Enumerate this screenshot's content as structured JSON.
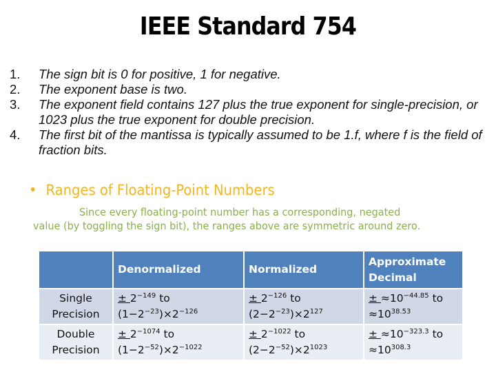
{
  "title": "IEEE Standard 754",
  "rules": [
    {
      "num": "1.",
      "text": "The sign bit is 0 for positive, 1 for negative."
    },
    {
      "num": "2.",
      "text": "The exponent base is two."
    },
    {
      "num": "3.",
      "text": "The exponent field contains 127 plus the true exponent for single-precision, or 1023 plus the true exponent for double precision."
    },
    {
      "num": "4.",
      "text": "The first bit of the mantissa is typically assumed to be 1.f, where f is the field of fraction bits."
    }
  ],
  "section": {
    "bullet": "•",
    "heading": "Ranges of Floating-Point Numbers",
    "note_line1": "Since every floating-point number has a corresponding, negated",
    "note_line2": "value (by toggling the sign bit), the ranges above are symmetric around zero."
  },
  "table": {
    "headers": [
      "",
      "Denormalized",
      "Normalized",
      "Approximate Decimal"
    ],
    "rows": [
      {
        "label": [
          "Single",
          "Precision"
        ],
        "denorm": {
          "a": "± ",
          "b": "2",
          "bsup": "−149",
          "c": " to",
          "d": "(1−2",
          "dsup": "−23",
          "e": ")×2",
          "esup": "−126"
        },
        "norm": {
          "a": "± ",
          "b": "2",
          "bsup": "−126",
          "c": " to",
          "d": "(2−2",
          "dsup": "−23",
          "e": ")×2",
          "esup": "127"
        },
        "approx": {
          "a": "± ",
          "b": "≈10",
          "bsup": "−44.85",
          "c": " to",
          "d": "≈10",
          "dsup": "38.53"
        }
      },
      {
        "label": [
          "Double",
          "Precision"
        ],
        "denorm": {
          "a": "± ",
          "b": "2",
          "bsup": "−1074",
          "c": " to",
          "d": "(1−2",
          "dsup": "−52",
          "e": ")×2",
          "esup": "−1022"
        },
        "norm": {
          "a": "± ",
          "b": "2",
          "bsup": "−1022",
          "c": " to",
          "d": "(2−2",
          "dsup": "−52",
          "e": ")×2",
          "esup": "1023"
        },
        "approx": {
          "a": "± ",
          "b": "≈10",
          "bsup": "−323.3",
          "c": " to",
          "d": "≈10",
          "dsup": "308.3"
        }
      }
    ]
  },
  "colors": {
    "header_bg": "#4f81bd",
    "row1_bg": "#d0d8e8",
    "row2_bg": "#e9edf4",
    "heading_color": "#f2b51e",
    "note_color": "#88b04b"
  }
}
